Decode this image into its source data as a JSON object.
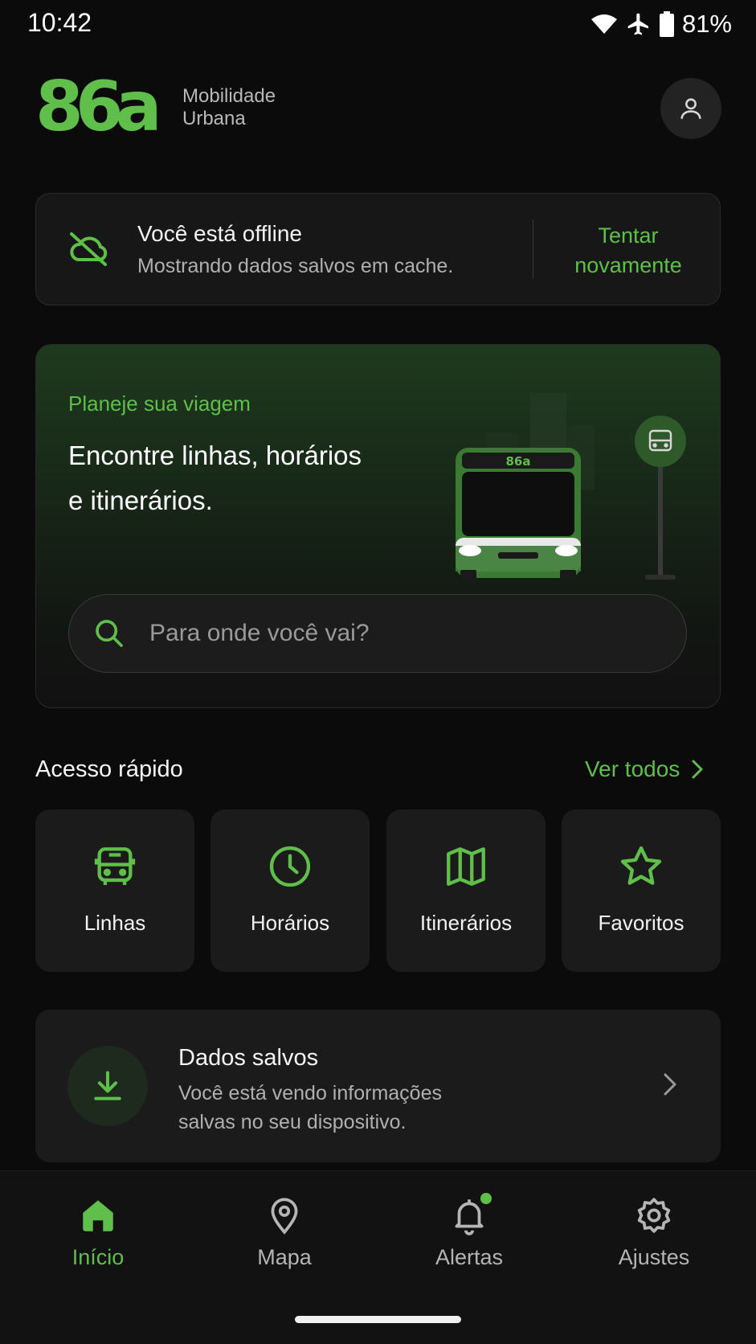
{
  "status_bar": {
    "time": "10:42",
    "battery": "81%",
    "icons": [
      "wifi-icon",
      "airplane-icon",
      "battery-icon"
    ]
  },
  "header": {
    "logo_text": "86a",
    "brand_line1": "Mobilidade",
    "brand_line2": "Urbana",
    "profile_icon": "user-icon"
  },
  "offline_banner": {
    "icon": "cloud-off-icon",
    "title": "Você está offline",
    "subtitle": "Mostrando dados salvos em cache.",
    "retry_line1": "Tentar",
    "retry_line2": "novamente"
  },
  "hero": {
    "eyebrow": "Planeje sua viagem",
    "title_line1": "Encontre linhas, horários",
    "title_line2": "e itinerários.",
    "bus_label": "86a",
    "search_placeholder": "Para onde você vai?"
  },
  "quick_access": {
    "title": "Acesso rápido",
    "see_all": "Ver todos",
    "items": [
      {
        "label": "Linhas",
        "icon": "bus-icon"
      },
      {
        "label": "Horários",
        "icon": "clock-icon"
      },
      {
        "label": "Itinerários",
        "icon": "map-icon"
      },
      {
        "label": "Favoritos",
        "icon": "star-icon"
      }
    ]
  },
  "saved_data": {
    "icon": "download-icon",
    "title": "Dados salvos",
    "subtitle_line1": "Você está vendo informações",
    "subtitle_line2": "salvas no seu dispositivo."
  },
  "bottom_nav": {
    "items": [
      {
        "label": "Início",
        "icon": "home-icon",
        "active": true
      },
      {
        "label": "Mapa",
        "icon": "map-pin-icon",
        "active": false
      },
      {
        "label": "Alertas",
        "icon": "bell-icon",
        "active": false
      },
      {
        "label": "Ajustes",
        "icon": "gear-icon",
        "active": false
      }
    ]
  },
  "colors": {
    "background": "#0b0b0b",
    "accent": "#5fbf4a",
    "card": "#1b1b1b"
  }
}
